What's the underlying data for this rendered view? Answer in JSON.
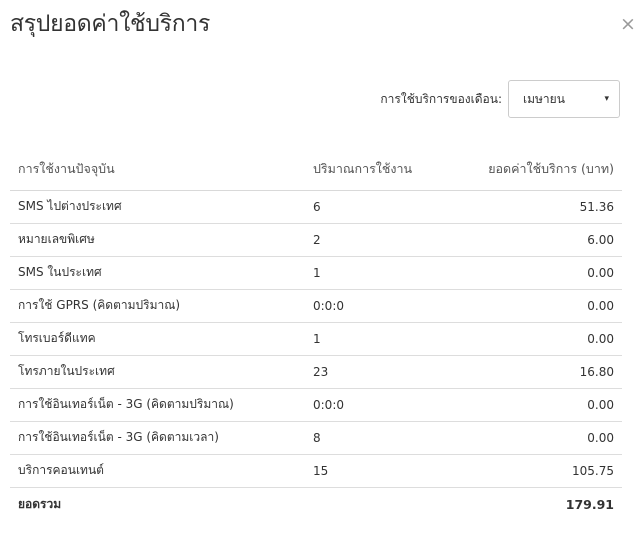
{
  "dialog": {
    "title": "สรุปยอดค่าใช้บริการ",
    "close_symbol": "×"
  },
  "month_filter": {
    "label": "การใช้บริการของเดือน:",
    "selected": "เมษายน",
    "caret_symbol": "▾"
  },
  "table": {
    "headers": {
      "service": "การใช้งานปัจจุบัน",
      "quantity": "ปริมาณการใช้งาน",
      "amount": "ยอดค่าใช้บริการ (บาท)"
    },
    "rows": [
      {
        "service": "SMS ไปต่างประเทศ",
        "quantity": "6",
        "amount": "51.36"
      },
      {
        "service": "หมายเลขพิเศษ",
        "quantity": "2",
        "amount": "6.00"
      },
      {
        "service": "SMS ในประเทศ",
        "quantity": "1",
        "amount": "0.00"
      },
      {
        "service": "การใช้ GPRS (คิดตามปริมาณ)",
        "quantity": "0:0:0",
        "amount": "0.00"
      },
      {
        "service": "โทรเบอร์ดีแทค",
        "quantity": "1",
        "amount": "0.00"
      },
      {
        "service": "โทรภายในประเทศ",
        "quantity": "23",
        "amount": "16.80"
      },
      {
        "service": "การใช้อินเทอร์เน็ต - 3G (คิดตามปริมาณ)",
        "quantity": "0:0:0",
        "amount": "0.00"
      },
      {
        "service": "การใช้อินเทอร์เน็ต - 3G (คิดตามเวลา)",
        "quantity": "8",
        "amount": "0.00"
      },
      {
        "service": "บริการคอนเทนต์",
        "quantity": "15",
        "amount": "105.75"
      }
    ],
    "total": {
      "label": "ยอดรวม",
      "amount": "179.91"
    }
  }
}
